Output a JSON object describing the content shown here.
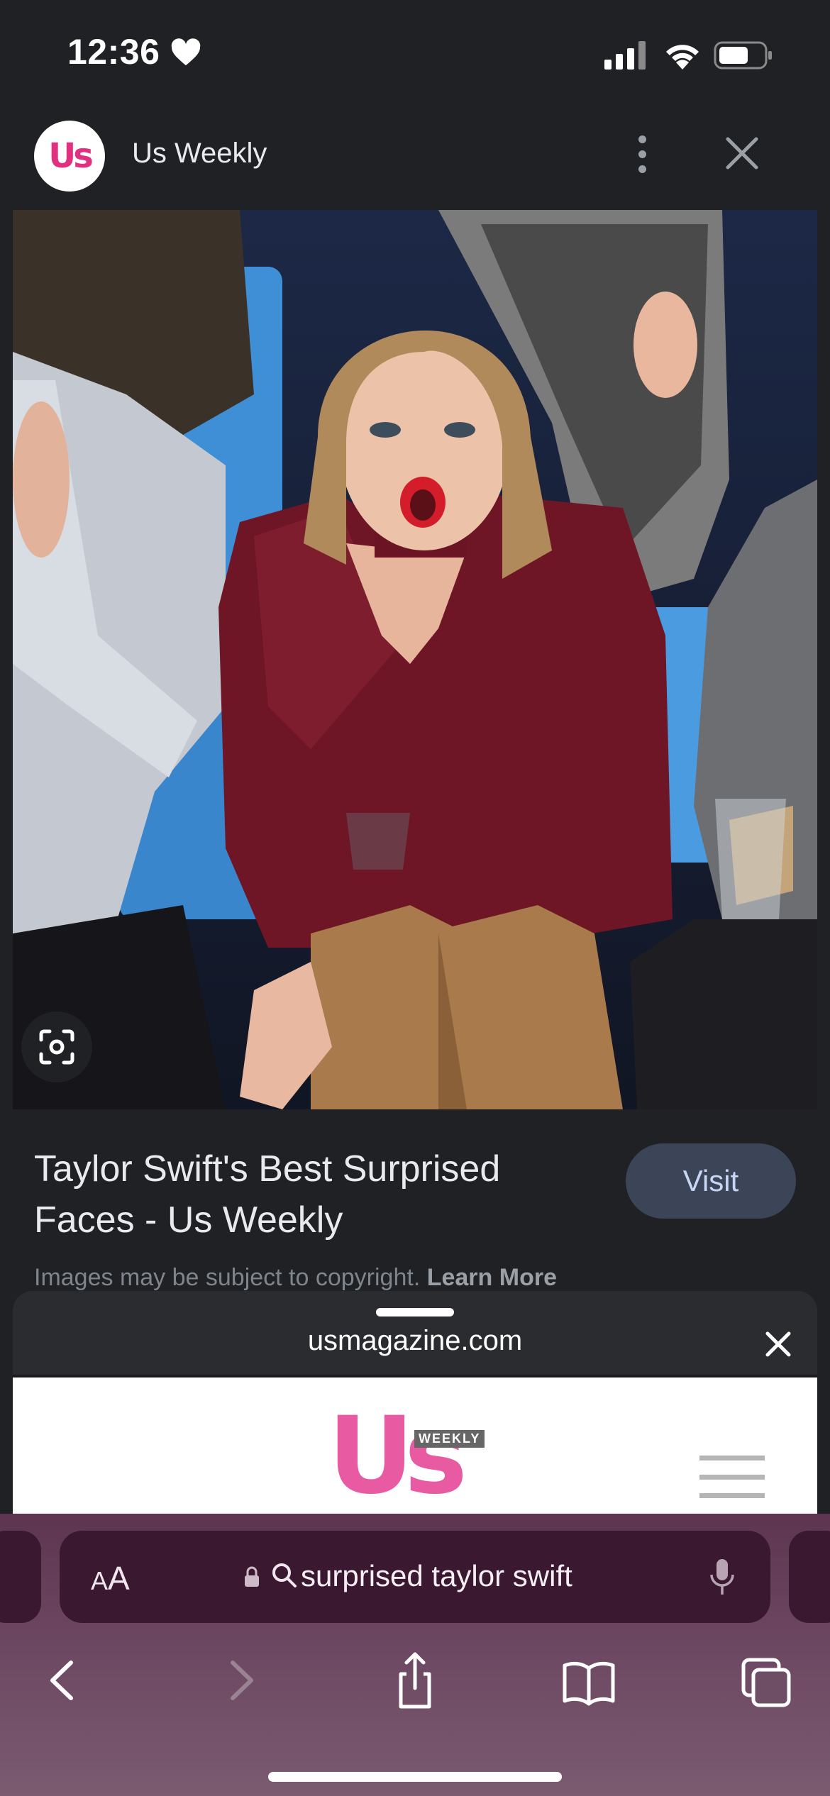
{
  "status_bar": {
    "time": "12:36"
  },
  "header": {
    "logo_text": "Us",
    "site_name": "Us Weekly"
  },
  "result": {
    "title": "Taylor Swift's Best Surprised Faces - Us Weekly",
    "visit_label": "Visit",
    "copyright_text": "Images may be subject to copyright.",
    "learn_more": "Learn More"
  },
  "sheet": {
    "url": "usmagazine.com",
    "preview_logo": "Us",
    "preview_tag": "WEEKLY"
  },
  "toolbar": {
    "text_size_small": "A",
    "text_size_large": "A",
    "address_text": "surprised taylor swift"
  },
  "colors": {
    "background": "#202124",
    "visit_button": "#3c4557",
    "toolbar_tint": "#6b4560",
    "brand_pink": "#e0307f"
  }
}
